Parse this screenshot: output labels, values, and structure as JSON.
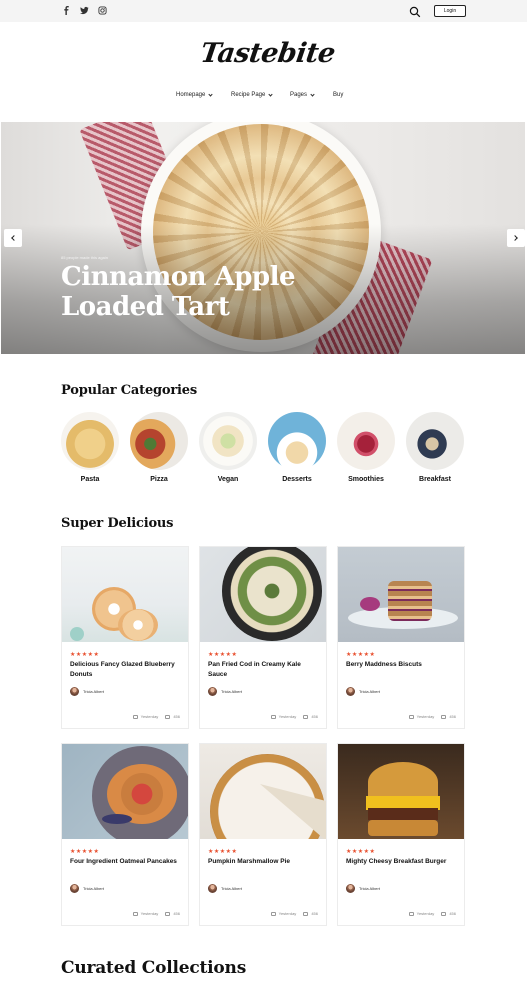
{
  "topbar": {
    "social": [
      {
        "name": "facebook-icon",
        "glyph": "f"
      },
      {
        "name": "twitter-icon",
        "glyph": "t"
      },
      {
        "name": "instagram-icon",
        "glyph": "i"
      }
    ],
    "login_label": "Login"
  },
  "brand": {
    "logo_text": "Tastebite"
  },
  "nav": {
    "items": [
      {
        "label": "Homepage",
        "has_dropdown": true
      },
      {
        "label": "Recipe Page",
        "has_dropdown": true
      },
      {
        "label": "Pages",
        "has_dropdown": true
      },
      {
        "label": "Buy",
        "has_dropdown": false
      }
    ]
  },
  "hero": {
    "meta": "85 people made this again",
    "title_line1": "Cinnamon Apple",
    "title_line2": "Loaded Tart",
    "prev_icon": "chevron-left-icon",
    "next_icon": "chevron-right-icon"
  },
  "categories": {
    "title": "Popular Categories",
    "items": [
      {
        "label": "Pasta"
      },
      {
        "label": "Pizza"
      },
      {
        "label": "Vegan"
      },
      {
        "label": "Desserts"
      },
      {
        "label": "Smoothies"
      },
      {
        "label": "Breakfast"
      }
    ]
  },
  "super_delicious": {
    "title": "Super Delicious",
    "cards": [
      {
        "title": "Delicious Fancy Glazed Blueberry Donuts",
        "stars": "★★★★★",
        "author": "Tricia Albert",
        "date": "Yesterday",
        "comments": "456"
      },
      {
        "title": "Pan Fried Cod in Creamy Kale Sauce",
        "stars": "★★★★★",
        "author": "Tricia Albert",
        "date": "Yesterday",
        "comments": "456"
      },
      {
        "title": "Berry Maddness Biscuts",
        "stars": "★★★★★",
        "author": "Tricia Albert",
        "date": "Yesterday",
        "comments": "456"
      },
      {
        "title": "Four Ingredient Oatmeal Pancakes",
        "stars": "★★★★★",
        "author": "Tricia Albert",
        "date": "Yesterday",
        "comments": "456"
      },
      {
        "title": "Pumpkin Marshmallow Pie",
        "stars": "★★★★★",
        "author": "Tricia Albert",
        "date": "Yesterday",
        "comments": "456"
      },
      {
        "title": "Mighty Cheesy Breakfast Burger",
        "stars": "★★★★★",
        "author": "Tricia Albert",
        "date": "Yesterday",
        "comments": "456"
      }
    ]
  },
  "curated": {
    "title": "Curated Collections"
  },
  "colors": {
    "accent": "#e8502f",
    "text": "#111111",
    "topbar_bg": "#f4f4f4"
  }
}
